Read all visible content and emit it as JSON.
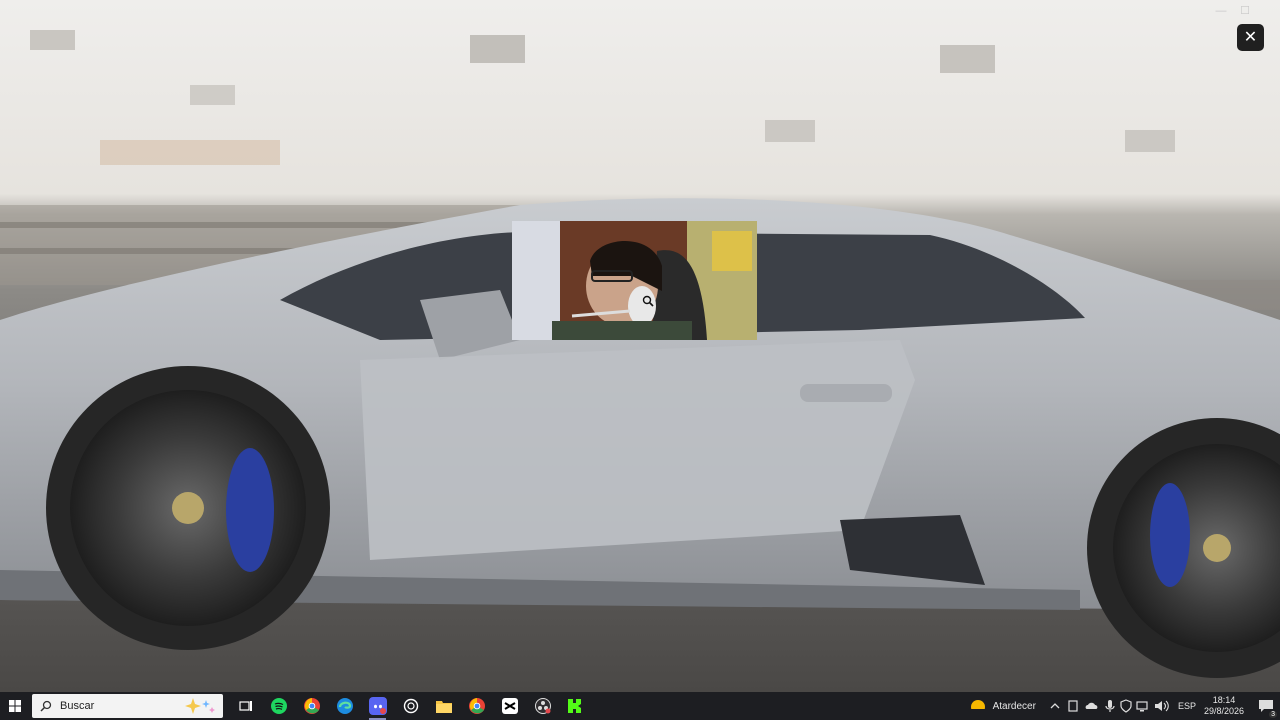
{
  "window": {
    "minimize_glyph": "—",
    "maximize_glyph": "☐",
    "close_glyph": "✕"
  },
  "viewer": {
    "close_glyph": "✕",
    "photo_description_icon": "sports-car-photo",
    "overlay_icon": "webcam-overlay",
    "cursor_icon": "zoom-in-cursor-icon"
  },
  "taskbar": {
    "search_placeholder": "Buscar",
    "apps": [
      {
        "name": "task-view"
      },
      {
        "name": "spotify"
      },
      {
        "name": "chrome"
      },
      {
        "name": "edge"
      },
      {
        "name": "discord",
        "active": true
      },
      {
        "name": "chatgpt"
      },
      {
        "name": "file-explorer"
      },
      {
        "name": "chrome-alt"
      },
      {
        "name": "capcut"
      },
      {
        "name": "obs"
      },
      {
        "name": "kick"
      }
    ],
    "weather_label": "Atardecer",
    "language": "ESP",
    "time": "18:14",
    "date": "29/8/2026",
    "notification_count": "3"
  },
  "colors": {
    "taskbar_bg": "#1d1e22",
    "accent": "#8a8fbf"
  }
}
